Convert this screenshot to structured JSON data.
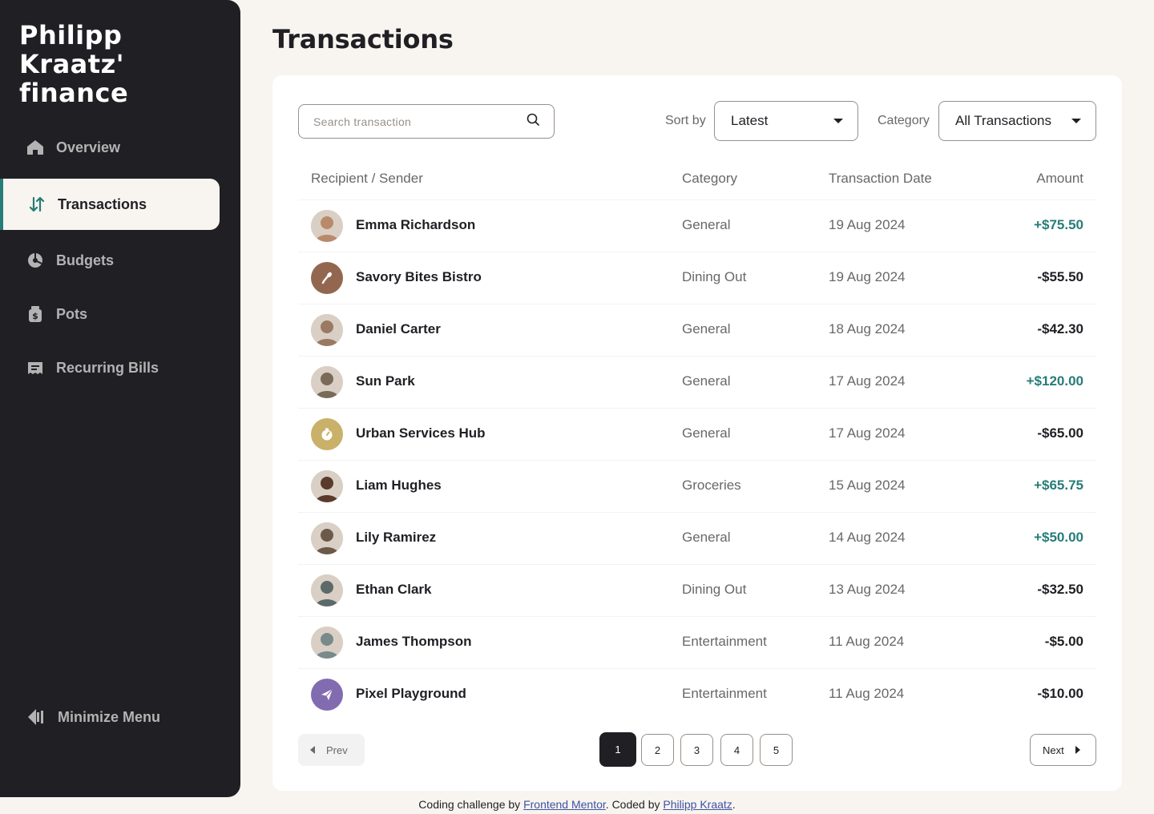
{
  "brand": {
    "line1": "Philipp Kraatz'",
    "line2": "finance"
  },
  "nav": [
    {
      "label": "Overview",
      "icon": "home-icon",
      "active": false
    },
    {
      "label": "Transactions",
      "icon": "arrows-up-down-icon",
      "active": true
    },
    {
      "label": "Budgets",
      "icon": "pie-chart-icon",
      "active": false
    },
    {
      "label": "Pots",
      "icon": "jar-icon",
      "active": false
    },
    {
      "label": "Recurring Bills",
      "icon": "receipt-icon",
      "active": false
    }
  ],
  "minimize_label": "Minimize Menu",
  "page_title": "Transactions",
  "search": {
    "placeholder": "Search transaction",
    "value": ""
  },
  "sort": {
    "label": "Sort by",
    "selected": "Latest"
  },
  "category_filter": {
    "label": "Category",
    "selected": "All Transactions"
  },
  "table": {
    "headers": [
      "Recipient / Sender",
      "Category",
      "Transaction Date",
      "Amount"
    ],
    "rows": [
      {
        "name": "Emma Richardson",
        "category": "General",
        "date": "19 Aug 2024",
        "amount": "+$75.50",
        "positive": true,
        "avatar": "photo",
        "color": "#b98a6a"
      },
      {
        "name": "Savory Bites Bistro",
        "category": "Dining Out",
        "date": "19 Aug 2024",
        "amount": "-$55.50",
        "positive": false,
        "avatar": "fork-icon",
        "color": "#93674f"
      },
      {
        "name": "Daniel Carter",
        "category": "General",
        "date": "18 Aug 2024",
        "amount": "-$42.30",
        "positive": false,
        "avatar": "photo",
        "color": "#9a7a62"
      },
      {
        "name": "Sun Park",
        "category": "General",
        "date": "17 Aug 2024",
        "amount": "+$120.00",
        "positive": true,
        "avatar": "photo",
        "color": "#7a6a58"
      },
      {
        "name": "Urban Services Hub",
        "category": "General",
        "date": "17 Aug 2024",
        "amount": "-$65.00",
        "positive": false,
        "avatar": "clock-icon",
        "color": "#c9b16a"
      },
      {
        "name": "Liam Hughes",
        "category": "Groceries",
        "date": "15 Aug 2024",
        "amount": "+$65.75",
        "positive": true,
        "avatar": "photo",
        "color": "#5a3b2b"
      },
      {
        "name": "Lily Ramirez",
        "category": "General",
        "date": "14 Aug 2024",
        "amount": "+$50.00",
        "positive": true,
        "avatar": "photo",
        "color": "#6b5a4a"
      },
      {
        "name": "Ethan Clark",
        "category": "Dining Out",
        "date": "13 Aug 2024",
        "amount": "-$32.50",
        "positive": false,
        "avatar": "photo",
        "color": "#5c6b6a"
      },
      {
        "name": "James Thompson",
        "category": "Entertainment",
        "date": "11 Aug 2024",
        "amount": "-$5.00",
        "positive": false,
        "avatar": "photo",
        "color": "#7a8a8a"
      },
      {
        "name": "Pixel Playground",
        "category": "Entertainment",
        "date": "11 Aug 2024",
        "amount": "-$10.00",
        "positive": false,
        "avatar": "paper-plane-icon",
        "color": "#826cb0"
      }
    ]
  },
  "pagination": {
    "prev": "Prev",
    "next": "Next",
    "pages": [
      "1",
      "2",
      "3",
      "4",
      "5"
    ],
    "current": "1"
  },
  "footer": {
    "pre": "Coding challenge by ",
    "link1": "Frontend Mentor",
    "mid": ". Coded by ",
    "link2": "Philipp Kraatz",
    "post": "."
  }
}
